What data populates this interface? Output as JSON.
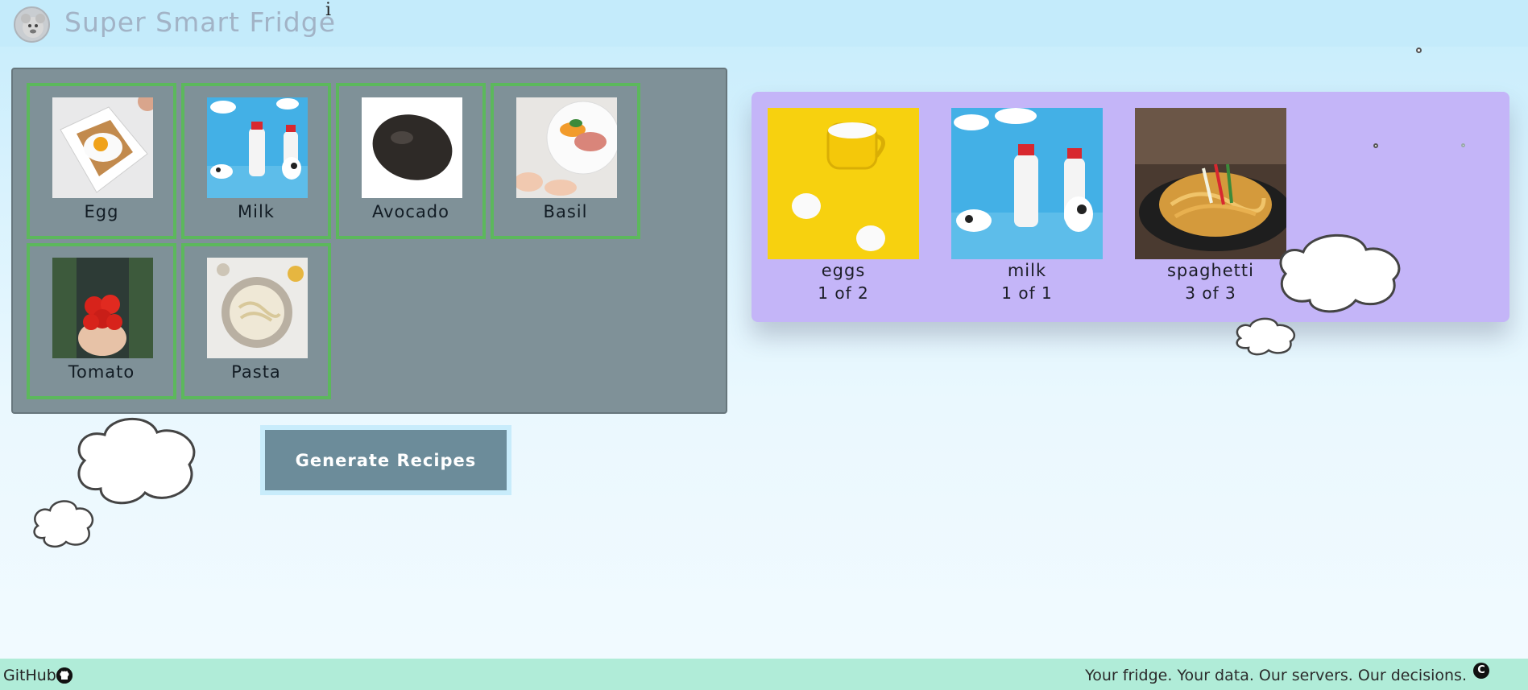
{
  "app": {
    "title": "Super Smart Fridge",
    "info_glyph": "i"
  },
  "fridge": {
    "items": [
      {
        "label": "Egg",
        "icon": "egg-image"
      },
      {
        "label": "Milk",
        "icon": "milk-image"
      },
      {
        "label": "Avocado",
        "icon": "avocado-image"
      },
      {
        "label": "Basil",
        "icon": "basil-image"
      },
      {
        "label": "Tomato",
        "icon": "tomato-image"
      },
      {
        "label": "Pasta",
        "icon": "pasta-image"
      }
    ]
  },
  "actions": {
    "generate_label": "Generate Recipes"
  },
  "recipes": {
    "items": [
      {
        "name": "eggs",
        "count": "1 of 2"
      },
      {
        "name": "milk",
        "count": "1 of 1"
      },
      {
        "name": "spaghetti",
        "count": "3 of 3"
      }
    ]
  },
  "footer": {
    "github_label": "GitHub",
    "tagline": "Your fridge. Your data. Our servers. Our decisions.",
    "copyright_glyph": "C"
  },
  "colors": {
    "fridge_panel": "#7f9198",
    "tile_border": "#5cb85c",
    "recipes_panel": "#c4b5f8",
    "button": "#6c8c9a",
    "footer": "#b0ecd8"
  }
}
